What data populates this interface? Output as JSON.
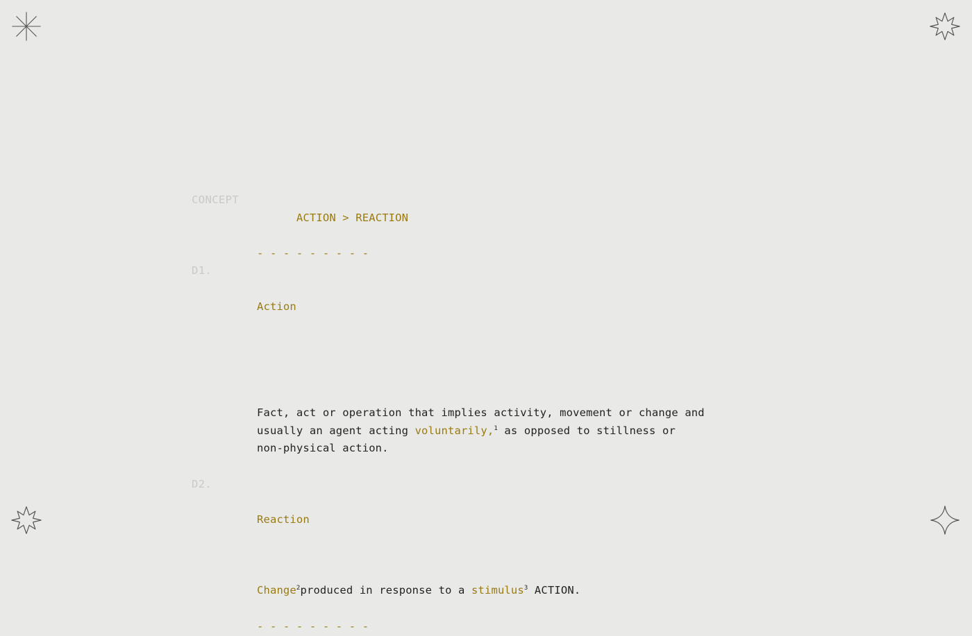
{
  "background_color": "#e9e9e7",
  "accent_color": "#9a7b12",
  "text_color": "#23231f",
  "muted_color": "#c9c9c5",
  "decor": {
    "top_left": "eight-point-asterisk-star",
    "top_right": "eight-point-star-outline",
    "bottom_left": "eight-point-star-outline",
    "bottom_right": "four-point-sparkle-outline"
  },
  "header": {
    "label": "CONCEPT",
    "title_first": "ACTION",
    "separator": ">",
    "title_second": "REACTION"
  },
  "rules": {
    "top": "- - - - - - - - -",
    "bottom": "- - - - - - - - -"
  },
  "definitions": [
    {
      "index": "D1.",
      "term": "Action",
      "body_lines": [
        {
          "parts": [
            {
              "text": "Fact, act or operation that implies activity, movement or change and",
              "style": "plain"
            }
          ]
        },
        {
          "parts": [
            {
              "text": "usually an agent acting ",
              "style": "plain"
            },
            {
              "text": "voluntarily,",
              "style": "gold",
              "sup": "1",
              "sup_style": "dark"
            },
            {
              "text": " as opposed to stillness or",
              "style": "plain"
            }
          ]
        },
        {
          "parts": [
            {
              "text": "non-physical action.",
              "style": "plain"
            }
          ]
        }
      ]
    },
    {
      "index": "D2.",
      "term": "Reaction",
      "body_lines": [
        {
          "parts": [
            {
              "text": "Change",
              "style": "gold",
              "sup": "2",
              "sup_style": "dark"
            },
            {
              "text": "produced in response to a ",
              "style": "plain"
            },
            {
              "text": "stimulus",
              "style": "gold",
              "sup": "3",
              "sup_style": "dark"
            },
            {
              "text": " ACTION.",
              "style": "plain"
            }
          ]
        }
      ]
    }
  ]
}
